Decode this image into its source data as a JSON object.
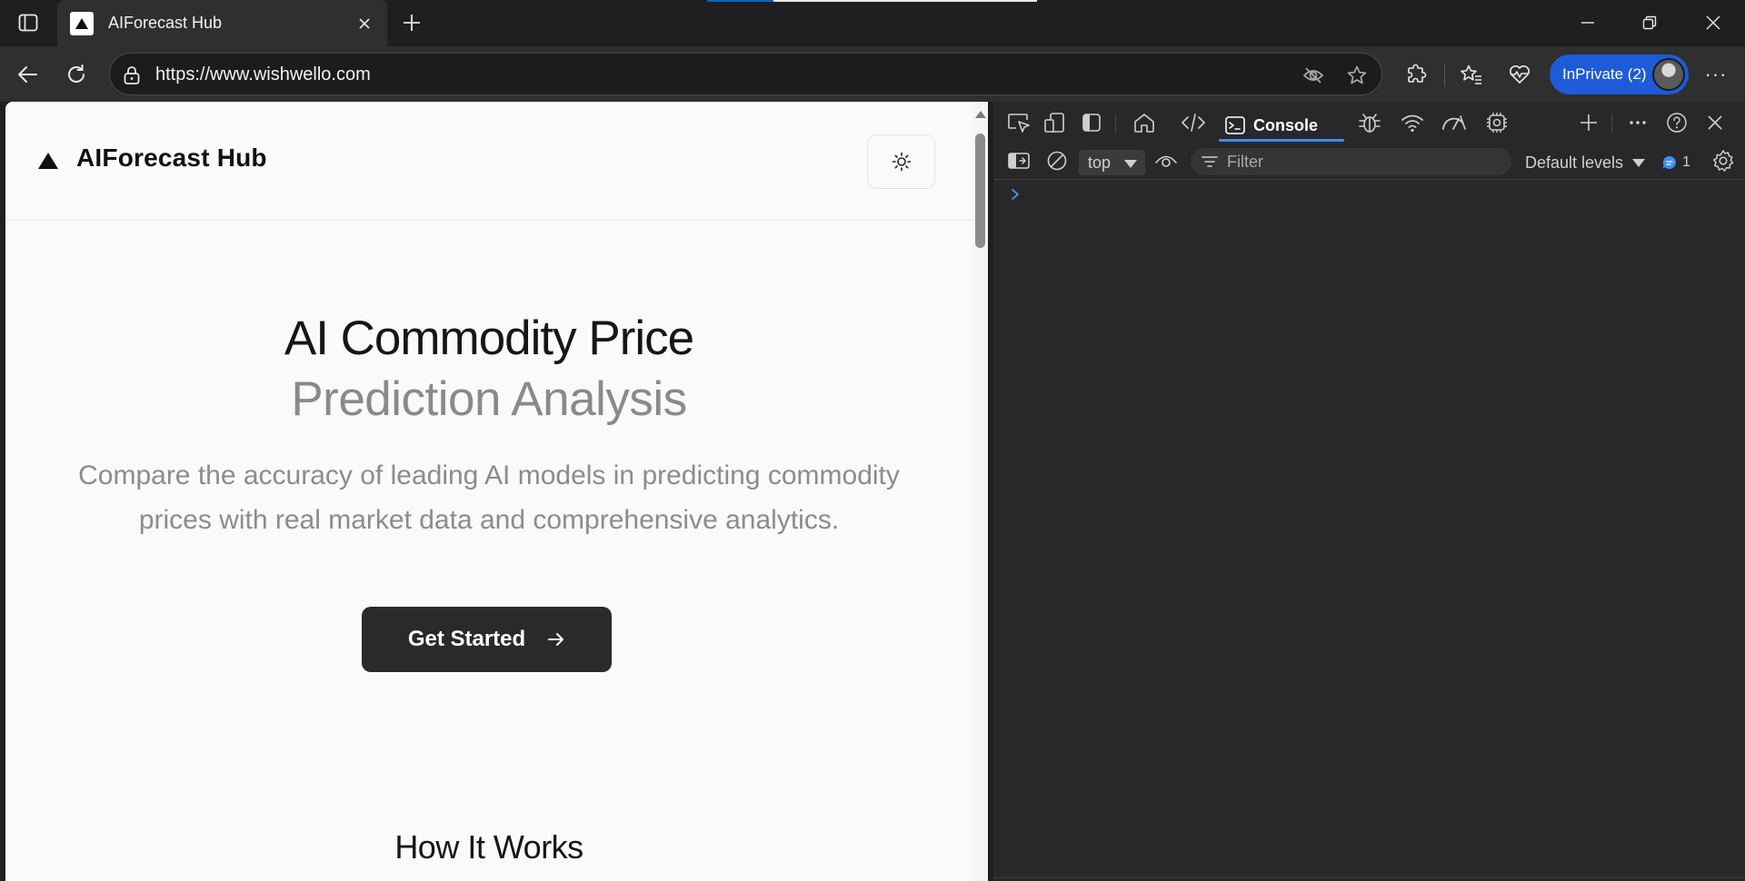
{
  "browser": {
    "tab": {
      "title": "AIForecast Hub"
    },
    "address_bar": {
      "url": "https://www.wishwello.com"
    },
    "inprivate": {
      "label": "InPrivate (2)"
    },
    "more_label": "···"
  },
  "page": {
    "site_title": "AIForecast Hub",
    "hero": {
      "title_line1": "AI Commodity Price",
      "title_line2": "Prediction Analysis",
      "subtitle": "Compare the accuracy of leading AI models in predicting commodity prices with real market data and comprehensive analytics."
    },
    "cta": {
      "label": "Get Started"
    },
    "section_title": "How It Works"
  },
  "devtools": {
    "active_tab": "Console",
    "context": "top",
    "filter_placeholder": "Filter",
    "levels": "Default levels",
    "issues_count": "1"
  },
  "colors": {
    "accent": "#1e5bd8",
    "devtools_accent": "#3c8ef5",
    "cta_background": "#2a2a2a"
  }
}
